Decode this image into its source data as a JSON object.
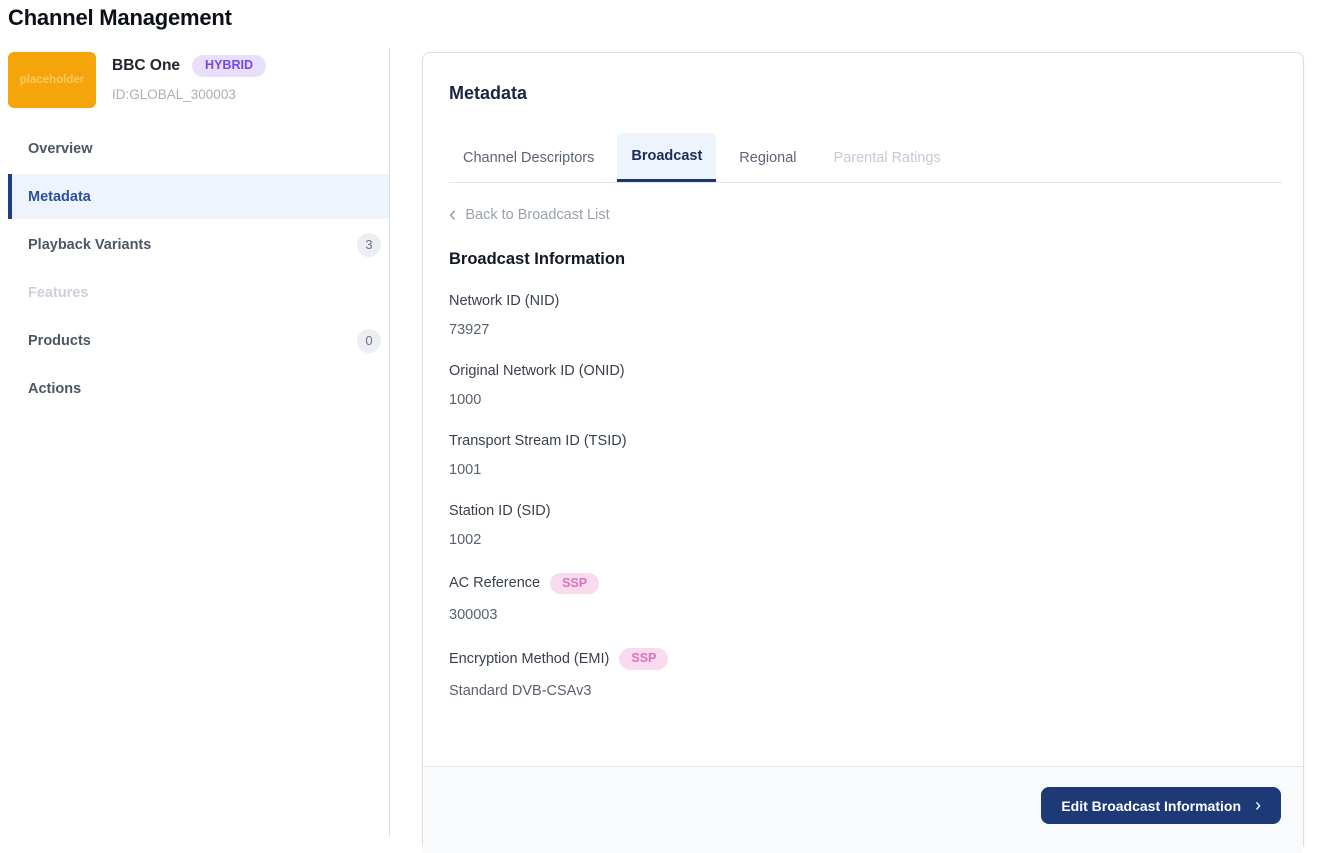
{
  "page": {
    "title": "Channel Management"
  },
  "icons": {
    "chevron_left": "‹",
    "chevron_right": "›"
  },
  "colors": {
    "brand_navy": "#1e3a76",
    "active_blue_text": "#2d4fa1",
    "active_row_bg": "#eef4fb",
    "active_border": "#1f3c88",
    "hybrid_badge_bg": "#e7dffc",
    "hybrid_badge_text": "#7b45e5",
    "ssp_badge_bg": "#f8dbee",
    "ssp_badge_text": "#d972bd",
    "logo_orange": "#f5a50a",
    "footer_bg": "#f8fafc"
  },
  "sidebar": {
    "channel": {
      "logo_text": "placeholder",
      "name": "BBC One",
      "type_badge": "HYBRID",
      "id": "ID:GLOBAL_300003"
    },
    "items": [
      {
        "label": "Overview",
        "state": "default"
      },
      {
        "label": "Metadata",
        "state": "active"
      },
      {
        "label": "Playback Variants",
        "state": "default",
        "badge": "3"
      },
      {
        "label": "Features",
        "state": "disabled"
      },
      {
        "label": "Products",
        "state": "default",
        "badge": "0"
      },
      {
        "label": "Actions",
        "state": "default"
      }
    ]
  },
  "main": {
    "title": "Metadata",
    "tabs": [
      {
        "label": "Channel Descriptors",
        "state": "default"
      },
      {
        "label": "Broadcast",
        "state": "active"
      },
      {
        "label": "Regional",
        "state": "default"
      },
      {
        "label": "Parental Ratings",
        "state": "disabled"
      }
    ],
    "back_link": "Back to Broadcast List",
    "section_title": "Broadcast Information",
    "fields": [
      {
        "label": "Network ID (NID)",
        "value": "73927"
      },
      {
        "label": "Original Network ID (ONID)",
        "value": "1000"
      },
      {
        "label": "Transport Stream ID (TSID)",
        "value": "1001"
      },
      {
        "label": "Station ID (SID)",
        "value": "1002"
      },
      {
        "label": "AC Reference",
        "badge": "SSP",
        "value": "300003"
      },
      {
        "label": "Encryption Method (EMI)",
        "badge": "SSP",
        "value": "Standard DVB-CSAv3"
      }
    ],
    "footer": {
      "edit_button_label": "Edit Broadcast Information"
    }
  }
}
